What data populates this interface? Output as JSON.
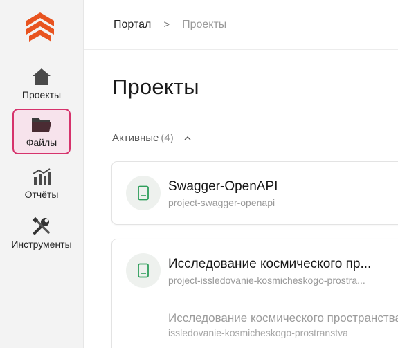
{
  "sidebar": {
    "logo": "company-logo",
    "items": [
      {
        "label": "Проекты",
        "icon": "home-icon"
      },
      {
        "label": "Файлы",
        "icon": "folder-icon",
        "active": true
      },
      {
        "label": "Отчёты",
        "icon": "chart-icon"
      },
      {
        "label": "Инструменты",
        "icon": "tools-icon"
      }
    ]
  },
  "breadcrumb": {
    "root": "Портал",
    "separator": ">",
    "current": "Проекты"
  },
  "page": {
    "title": "Проекты"
  },
  "section": {
    "label": "Активные",
    "count": "(4)"
  },
  "projects": [
    {
      "title": "Swagger-OpenAPI",
      "slug": "project-swagger-openapi",
      "icon": "book-icon"
    },
    {
      "title": "Исследование космического пр...",
      "slug": "project-issledovanie-kosmicheskogo-prostra...",
      "icon": "book-icon",
      "child": {
        "title": "Исследование космического пространства",
        "slug": "issledovanie-kosmicheskogo-prostranstva"
      }
    }
  ],
  "colors": {
    "accent": "#d6336c",
    "active_bg": "#f7e3ec",
    "logo": "#e8531f",
    "book_icon": "#2e9e5b"
  }
}
